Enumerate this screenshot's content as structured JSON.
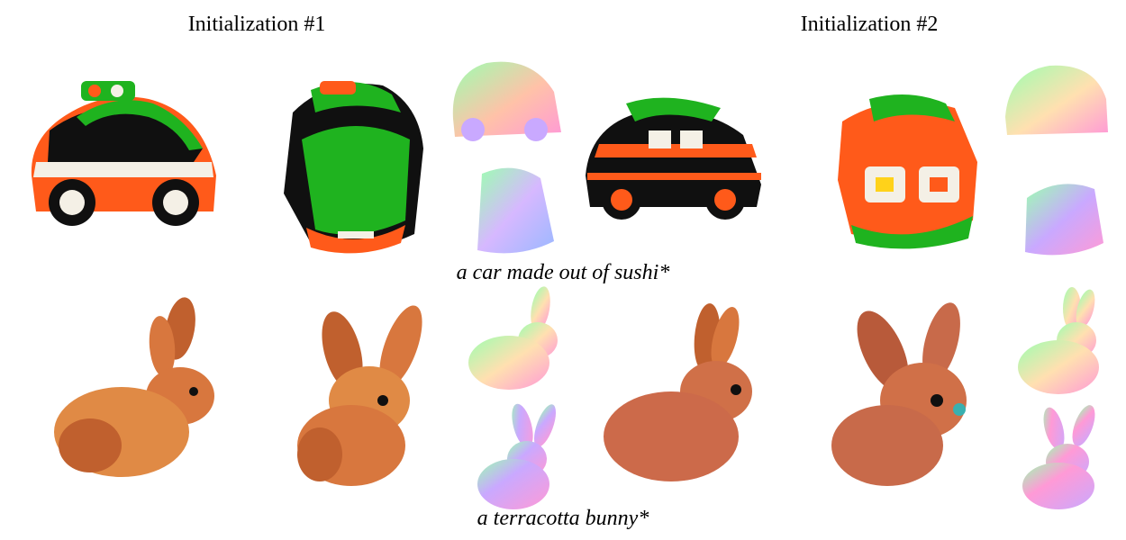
{
  "figure": {
    "headings": {
      "left": "Initialization #1",
      "right": "Initialization #2"
    },
    "rows": [
      {
        "prompt": "a car made out of sushi*"
      },
      {
        "prompt": "a terracotta bunny*"
      }
    ],
    "colors": {
      "sushi_green": "#1fb31f",
      "sushi_orange": "#ff5a1a",
      "sushi_white": "#f4f0e6",
      "nori_black": "#101010",
      "terracotta": "#d8773e",
      "normal_pink": "#ff9ad6",
      "normal_green": "#9cffb0",
      "normal_blue": "#9bb8ff"
    }
  }
}
